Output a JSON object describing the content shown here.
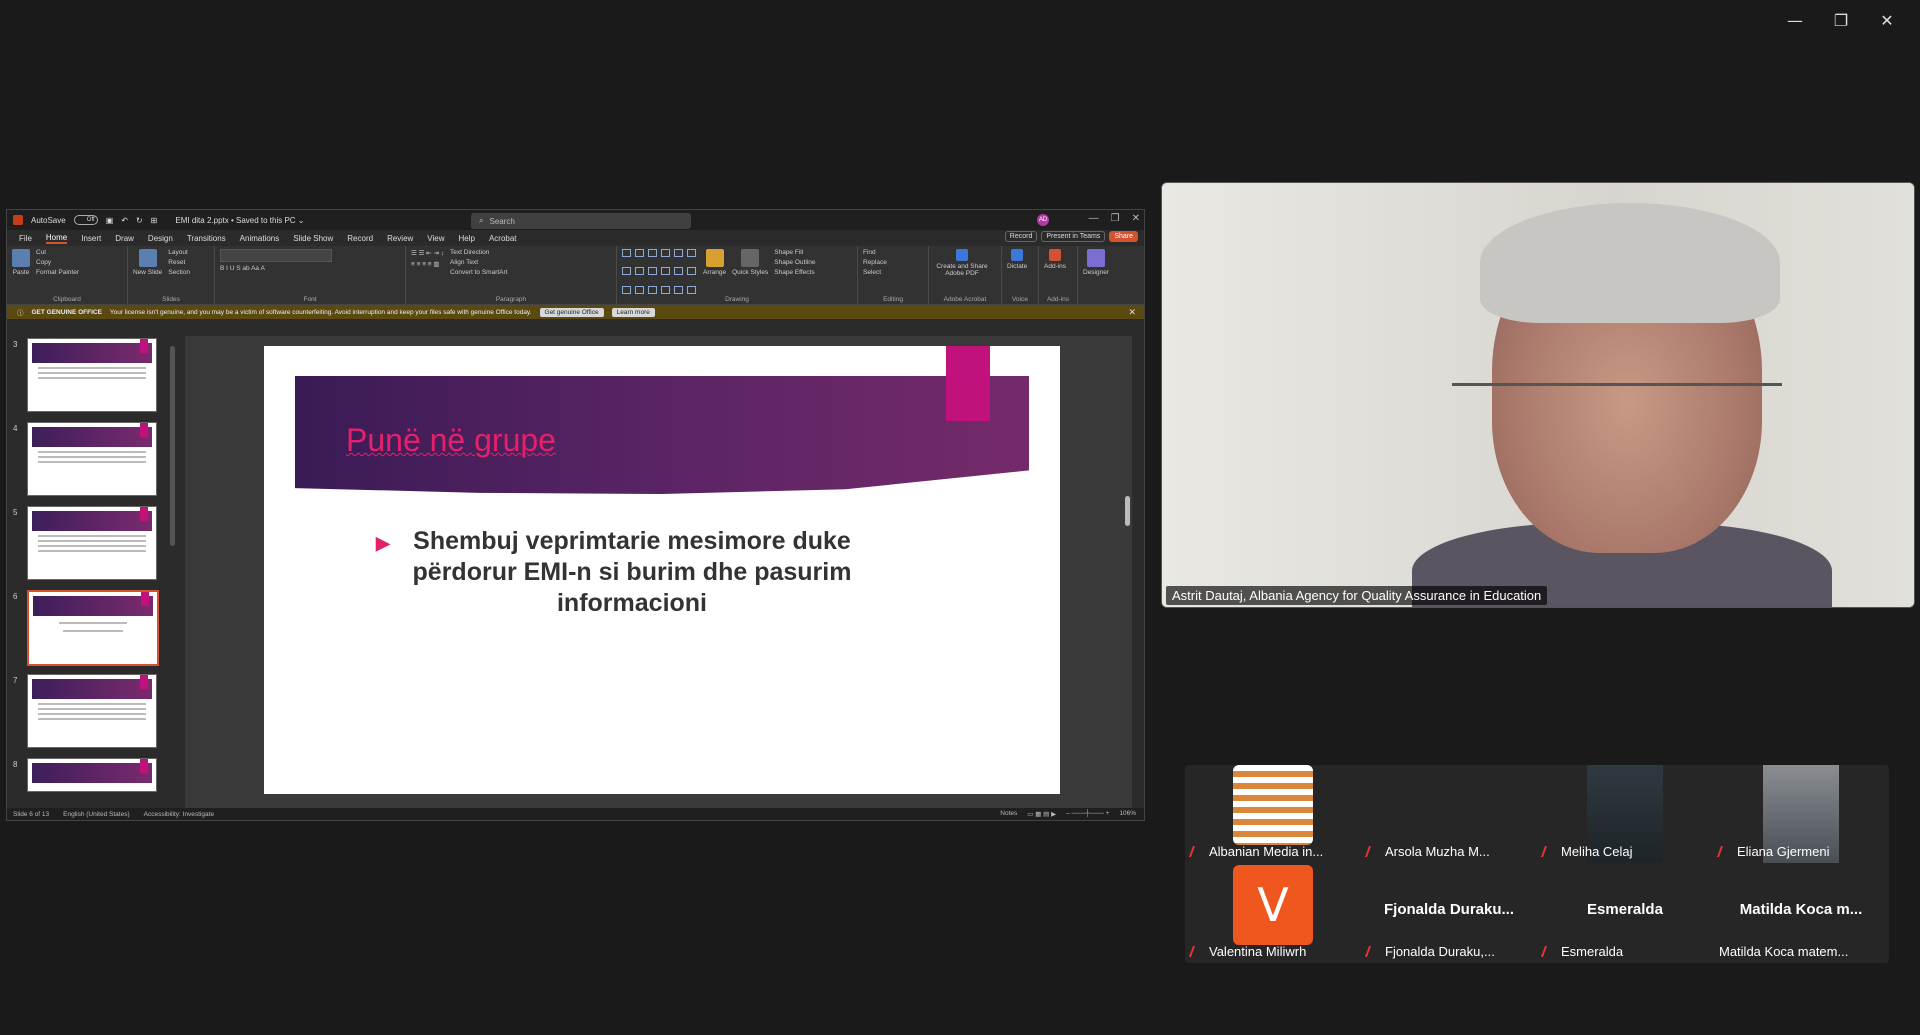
{
  "window_controls": {
    "minimize": "—",
    "restore": "❐",
    "close": "✕"
  },
  "ppt": {
    "autosave": "AutoSave",
    "autosave_state": "Off",
    "filename": "EMI dita 2.pptx • Saved to this PC ⌄",
    "search_placeholder": "Search",
    "avatar": "AD",
    "menu": [
      "File",
      "Home",
      "Insert",
      "Draw",
      "Design",
      "Transitions",
      "Animations",
      "Slide Show",
      "Record",
      "Review",
      "View",
      "Help",
      "Acrobat"
    ],
    "record": "Record",
    "present_teams": "Present in Teams",
    "share": "Share",
    "ribbon": {
      "clipboard": "Clipboard",
      "paste": "Paste",
      "cut": "Cut",
      "copy": "Copy",
      "format_painter": "Format Painter",
      "slides": "Slides",
      "new_slide": "New Slide",
      "layout": "Layout",
      "reset": "Reset",
      "section": "Section",
      "font": "Font",
      "paragraph": "Paragraph",
      "text_direction": "Text Direction",
      "align_text": "Align Text",
      "convert_smartart": "Convert to SmartArt",
      "drawing": "Drawing",
      "arrange": "Arrange",
      "quick_styles": "Quick Styles",
      "shape_fill": "Shape Fill",
      "shape_outline": "Shape Outline",
      "shape_effects": "Shape Effects",
      "editing": "Editing",
      "find": "Find",
      "replace": "Replace",
      "select": "Select",
      "adobe": "Adobe Acrobat",
      "create_share": "Create and Share Adobe PDF",
      "voice": "Voice",
      "dictate": "Dictate",
      "addins": "Add-ins",
      "addins_btn": "Add-ins",
      "designer": "Designer"
    },
    "banner": {
      "title": "GET GENUINE OFFICE",
      "message": "Your license isn't genuine, and you may be a victim of software counterfeiting. Avoid interruption and keep your files safe with genuine Office today.",
      "btn1": "Get genuine Office",
      "btn2": "Learn more"
    },
    "thumb_numbers": [
      "3",
      "4",
      "5",
      "6",
      "7",
      "8"
    ],
    "slide": {
      "title": "Punë në grupe",
      "bullet": "Shembuj veprimtarie mesimore duke përdorur EMI-n si burim dhe pasurim informacioni"
    },
    "status": {
      "slide": "Slide 6 of 13",
      "lang": "English (United States)",
      "access": "Accessibility: Investigate",
      "notes": "Notes",
      "zoom": "106%"
    }
  },
  "speaker": {
    "label": "Astrit Dautaj, Albania Agency for Quality Assurance in Education"
  },
  "participants": [
    {
      "name": "Albanian Media in...",
      "tile": "stripes"
    },
    {
      "name": "Arsola Muzha   M...",
      "tile": "none"
    },
    {
      "name": "Meliha Celaj",
      "tile": "photo1"
    },
    {
      "name": "Eliana Gjermeni",
      "tile": "photo2"
    },
    {
      "name": "Valentina Miliwrh",
      "tile": "letter",
      "letter": "V"
    },
    {
      "name": "Fjonalda Duraku,...",
      "big": "Fjonalda  Duraku..."
    },
    {
      "name": "Esmeralda",
      "big": "Esmeralda"
    },
    {
      "name": "Matilda Koca matem...",
      "big": "Matilda  Koca  m..."
    }
  ]
}
